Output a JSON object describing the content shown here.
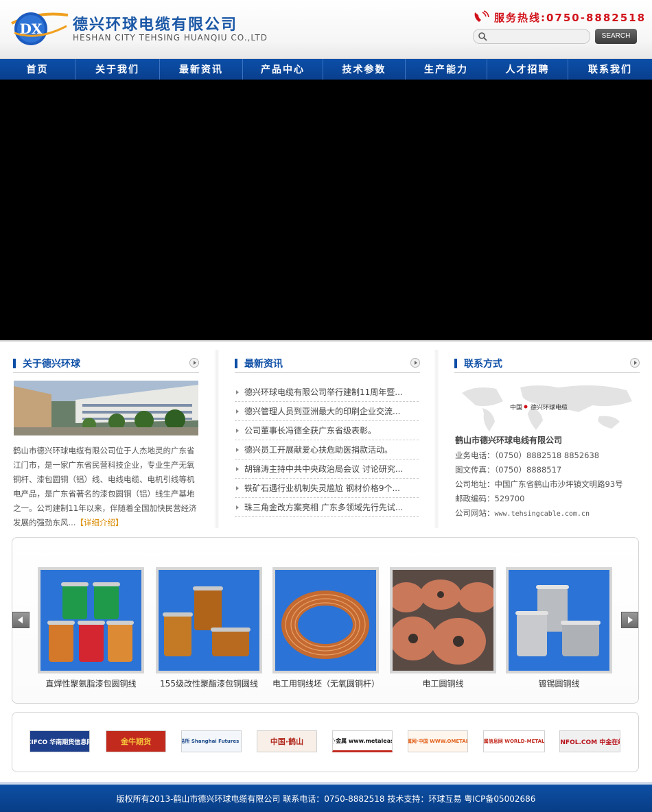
{
  "header": {
    "company_cn": "德兴环球电缆有限公司",
    "company_en": "HESHAN  CITY  TEHSING  HUANQIU CO.,LTD",
    "logo_text": "DX",
    "hotline": "服务热线:0750-8882518",
    "search_placeholder": "",
    "search_button": "SEARCH"
  },
  "nav": {
    "items": [
      {
        "label": "首页"
      },
      {
        "label": "关于我们"
      },
      {
        "label": "最新资讯"
      },
      {
        "label": "产品中心"
      },
      {
        "label": "技术参数"
      },
      {
        "label": "生产能力"
      },
      {
        "label": "人才招聘"
      },
      {
        "label": "联系我们"
      }
    ]
  },
  "about": {
    "title": "关于德兴环球",
    "text": "鹤山市德兴环球电缆有限公司位于人杰地灵的广东省江门市，是一家广东省民营科技企业，专业生产无氧铜杆、漆包圆铜（铝）线、电线电缆、电机引线等机电产品，是广东省著名的漆包圆铜（铝）线生产基地之一。公司建制11年以来，伴随着全国加快民营经济发展的强劲东风...",
    "more": "【详细介绍】"
  },
  "news": {
    "title": "最新资讯",
    "items": [
      "德兴环球电缆有限公司举行建制11周年暨...",
      "德兴管理人员到亚洲最大的印刷企业交流...",
      "公司董事长冯德全获广东省级表彰。",
      "德兴员工开展献爱心扶危助医捐款活动。",
      "胡锦涛主持中共中央政治局会议 讨论研究...",
      "铁矿石遇行业机制失灵尴尬 钢材价格9个...",
      "珠三角金改方案亮相 广东多领域先行先试..."
    ]
  },
  "contact": {
    "title": "联系方式",
    "map_label_china": "中国",
    "map_label_company": "德兴环球电缆",
    "company": "鹤山市德兴环球电线有限公司",
    "phone_label": "业务电话：",
    "phone": "（0750）8882518 8852638",
    "fax_label": "图文传真：",
    "fax": "（0750）8888517",
    "address_label": "公司地址：",
    "address": "中国广东省鹤山市沙坪镇文明路93号",
    "postcode_label": "邮政编码：",
    "postcode": "529700",
    "website_label": "公司网站：",
    "website": "www.tehsingcable.com.cn"
  },
  "products": {
    "items": [
      {
        "name": "直焊性聚氨脂漆包圆铜线"
      },
      {
        "name": "155级改性聚酯漆包铜圆线"
      },
      {
        "name": "电工用铜线坯（无氧圆铜杆）"
      },
      {
        "name": "电工圆铜线"
      },
      {
        "name": "镀锡圆铜线"
      }
    ]
  },
  "links": {
    "items": [
      {
        "label": "CIFCO 华南期货信息网"
      },
      {
        "label": "金牛期货"
      },
      {
        "label": "上海期货交易所 Shanghai Futures Exchange"
      },
      {
        "label": "中国·鹤山"
      },
      {
        "label": "CBI易贸·金属 www.metalease.com"
      },
      {
        "label": "全球金属网·中国 WWW.OMETAL.COM"
      },
      {
        "label": "环球金属信息网 WORLD-METAL.COM"
      },
      {
        "label": "CNFOL.COM 中金在线"
      }
    ]
  },
  "footer": {
    "text": "版权所有2013-鹤山市德兴环球电缆有限公司 联系电话：0750-8882518  技术支持：环球互易 粤ICP备05002686"
  },
  "colors": {
    "brand_blue": "#0d4ea6",
    "hotline_red": "#d2121b",
    "more_orange": "#d98a00"
  }
}
